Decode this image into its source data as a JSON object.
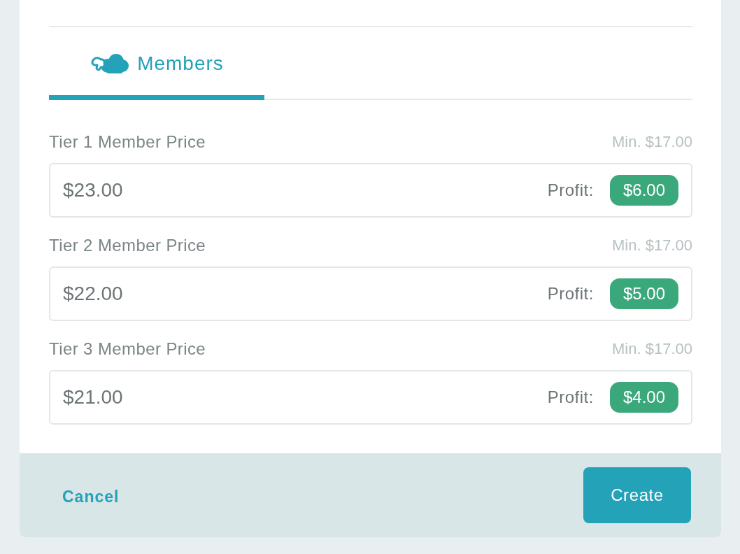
{
  "tabs": [
    {
      "label": "Members",
      "selected": true
    }
  ],
  "price_fields": [
    {
      "label": "Tier 1 Member Price",
      "minimum": "Min. $17.00",
      "value": "$23.00",
      "profit_label": "Profit:",
      "profit": "$6.00"
    },
    {
      "label": "Tier 2 Member Price",
      "minimum": "Min. $17.00",
      "value": "$22.00",
      "profit_label": "Profit:",
      "profit": "$5.00"
    },
    {
      "label": "Tier 3 Member Price",
      "minimum": "Min. $17.00",
      "value": "$21.00",
      "profit_label": "Profit:",
      "profit": "$4.00"
    }
  ],
  "footer": {
    "cancel": "Cancel",
    "create": "Create"
  }
}
